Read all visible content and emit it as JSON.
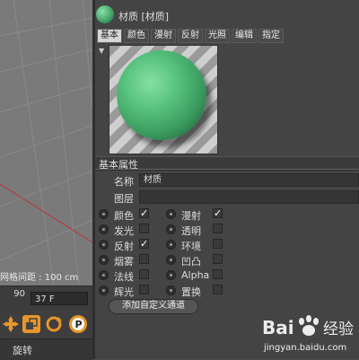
{
  "viewport": {
    "grid_spacing_label": "网格间距 : 100 cm",
    "frame_left_value": "90",
    "frame_field_value": "37 F",
    "rotate_label": "旋转"
  },
  "material": {
    "title": "材质 [材质]",
    "tabs": [
      "基本",
      "颜色",
      "漫射",
      "反射",
      "光照",
      "编辑",
      "指定"
    ],
    "active_tab": "基本",
    "section_title": "基本属性",
    "name_label": "名称",
    "name_value": "材质",
    "layer_label": "图层",
    "layer_value": "",
    "channels_left": [
      {
        "label": "颜色",
        "checked": true
      },
      {
        "label": "发光",
        "checked": false
      },
      {
        "label": "反射",
        "checked": true
      },
      {
        "label": "烟雾",
        "checked": false
      },
      {
        "label": "法线",
        "checked": false
      },
      {
        "label": "辉光",
        "checked": false
      }
    ],
    "channels_right": [
      {
        "label": "漫射",
        "checked": true
      },
      {
        "label": "透明",
        "checked": false
      },
      {
        "label": "环境",
        "checked": false
      },
      {
        "label": "凹凸",
        "checked": false
      },
      {
        "label": "Alpha",
        "checked": false
      },
      {
        "label": "置换",
        "checked": false
      }
    ],
    "add_channel_button": "添加自定义通道"
  },
  "watermark": {
    "brand": "Bai 经验",
    "url": "jingyan.baidu.com"
  },
  "colors": {
    "viewport_bg": "#7a7a7a",
    "panel_bg": "#444444",
    "sphere_green": "#55c07c",
    "tool_orange": "#e8962a"
  }
}
